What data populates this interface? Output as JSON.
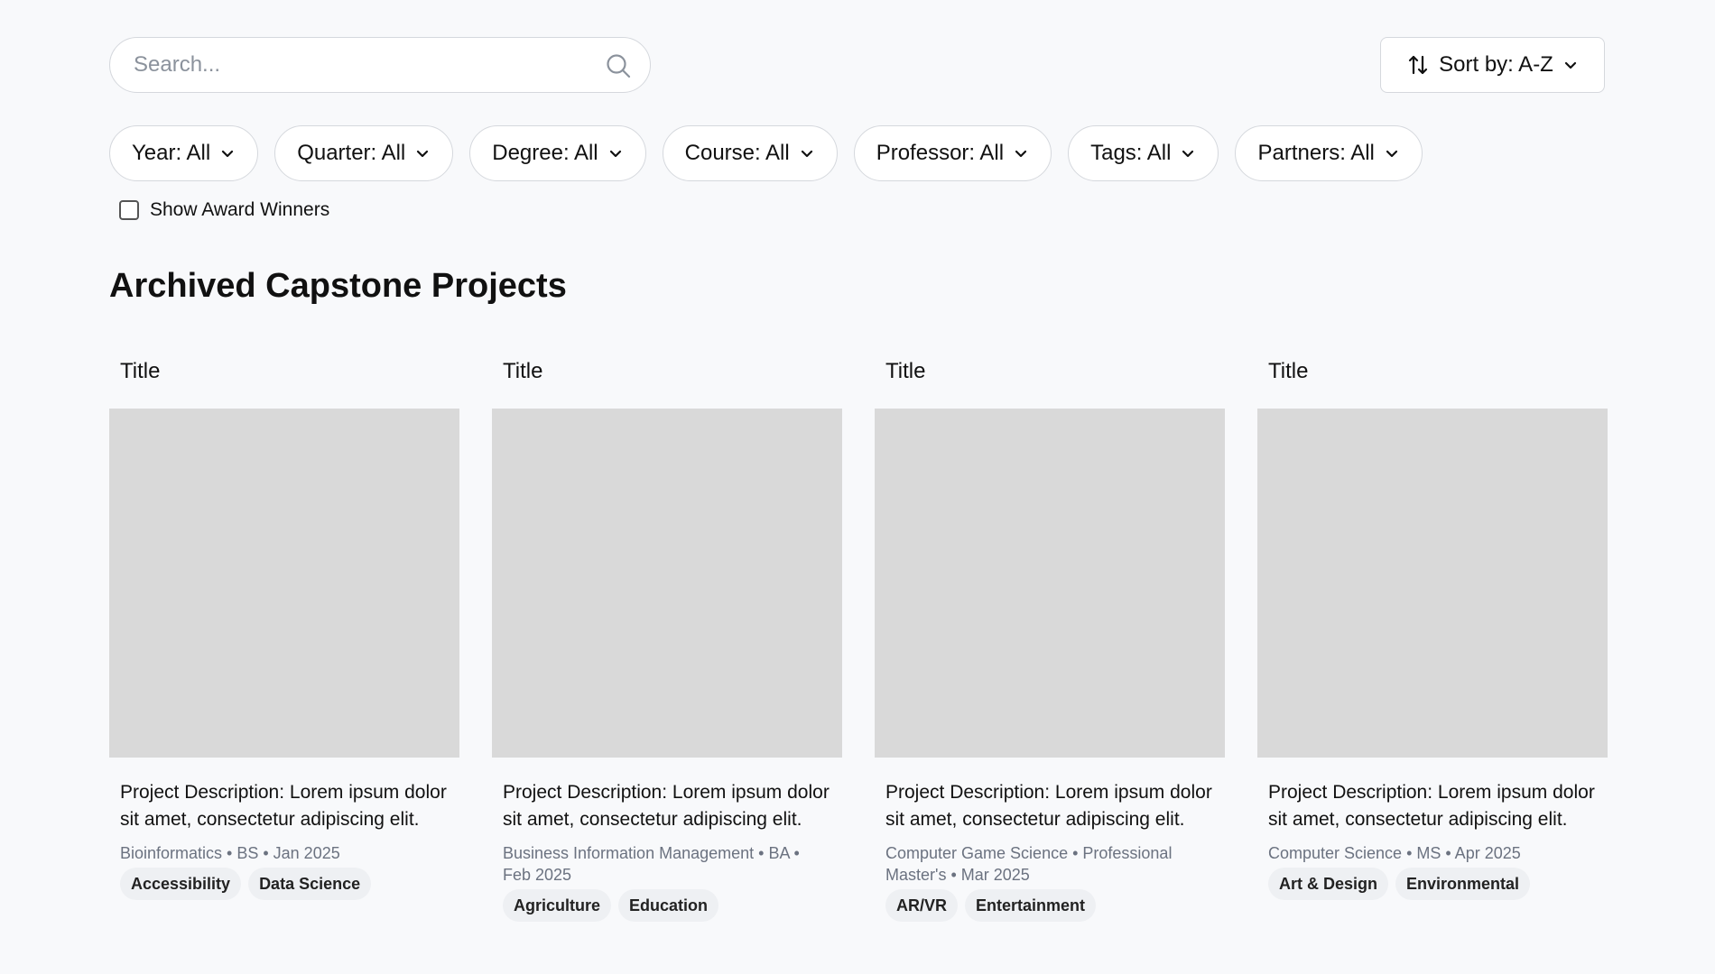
{
  "search": {
    "placeholder": "Search..."
  },
  "sort": {
    "label": "Sort by: A-Z"
  },
  "filters": [
    {
      "label": "Year: All"
    },
    {
      "label": "Quarter: All"
    },
    {
      "label": "Degree: All"
    },
    {
      "label": "Course: All"
    },
    {
      "label": "Professor: All"
    },
    {
      "label": "Tags: All"
    },
    {
      "label": "Partners: All"
    }
  ],
  "award_filter": {
    "label": "Show Award Winners",
    "checked": false
  },
  "page_title": "Archived Capstone Projects",
  "projects": [
    {
      "title": "Title",
      "description": "Project Description: Lorem ipsum dolor sit amet, consectetur adipiscing elit.",
      "meta": "Bioinformatics • BS • Jan 2025",
      "tags": [
        "Accessibility",
        "Data Science"
      ]
    },
    {
      "title": "Title",
      "description": "Project Description: Lorem ipsum dolor sit amet, consectetur adipiscing elit.",
      "meta": "Business Information Management • BA • Feb 2025",
      "tags": [
        "Agriculture",
        "Education"
      ]
    },
    {
      "title": "Title",
      "description": "Project Description: Lorem ipsum dolor sit amet, consectetur adipiscing elit.",
      "meta": "Computer Game Science • Professional Master's • Mar 2025",
      "tags": [
        "AR/VR",
        "Entertainment"
      ]
    },
    {
      "title": "Title",
      "description": "Project Description: Lorem ipsum dolor sit amet, consectetur adipiscing elit.",
      "meta": "Computer Science • MS • Apr 2025",
      "tags": [
        "Art & Design",
        "Environmental"
      ]
    }
  ]
}
